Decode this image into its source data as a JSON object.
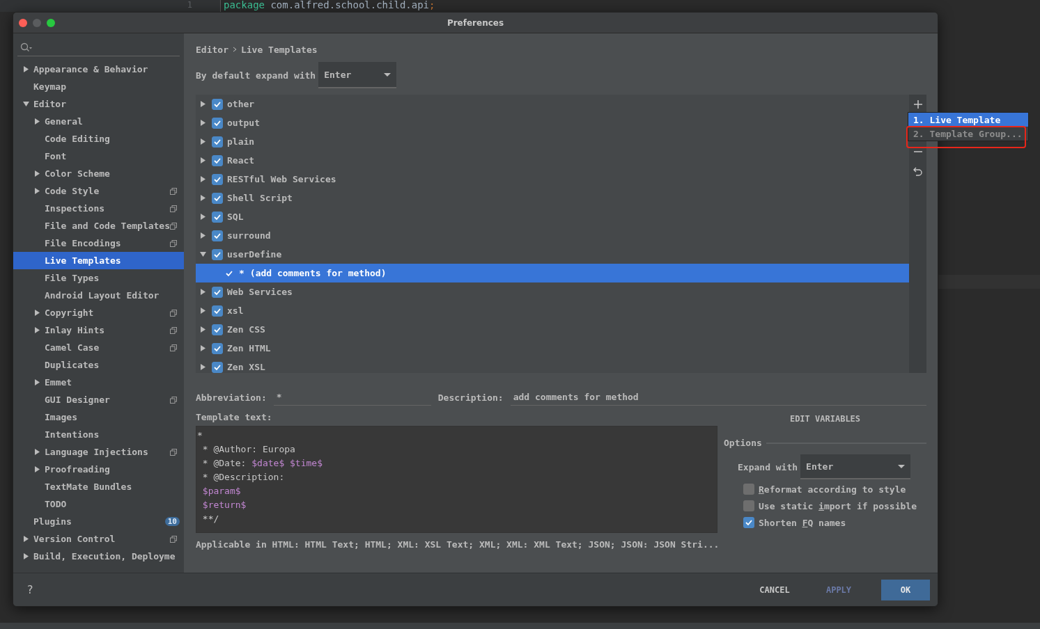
{
  "background_editor": {
    "line_number": "1",
    "code": [
      {
        "text": "package",
        "kind": "keyword"
      },
      {
        "text": " com.alfred.school.child.api",
        "kind": "plain"
      },
      {
        "text": ";",
        "kind": "punct"
      }
    ]
  },
  "window": {
    "title": "Preferences"
  },
  "sidebar": {
    "items": [
      {
        "label": "Appearance & Behavior",
        "expanded": false,
        "has_children": true,
        "selected": false
      },
      {
        "label": "Keymap",
        "selected": false
      },
      {
        "label": "Editor",
        "expanded": true,
        "has_children": true,
        "selected": false,
        "children": [
          {
            "label": "General",
            "has_children": true,
            "expanded": false,
            "selected": false
          },
          {
            "label": "Code Editing",
            "selected": false
          },
          {
            "label": "Font",
            "selected": false
          },
          {
            "label": "Color Scheme",
            "has_children": true,
            "expanded": false,
            "selected": false
          },
          {
            "label": "Code Style",
            "has_children": true,
            "expanded": false,
            "selected": false,
            "project_scoped": true
          },
          {
            "label": "Inspections",
            "selected": false,
            "project_scoped": true
          },
          {
            "label": "File and Code Templates",
            "selected": false,
            "project_scoped": true
          },
          {
            "label": "File Encodings",
            "selected": false,
            "project_scoped": true
          },
          {
            "label": "Live Templates",
            "selected": true
          },
          {
            "label": "File Types",
            "selected": false
          },
          {
            "label": "Android Layout Editor",
            "selected": false
          },
          {
            "label": "Copyright",
            "has_children": true,
            "expanded": false,
            "selected": false,
            "project_scoped": true
          },
          {
            "label": "Inlay Hints",
            "has_children": true,
            "expanded": false,
            "selected": false,
            "project_scoped": true
          },
          {
            "label": "Camel Case",
            "selected": false,
            "project_scoped": true
          },
          {
            "label": "Duplicates",
            "selected": false
          },
          {
            "label": "Emmet",
            "has_children": true,
            "expanded": false,
            "selected": false
          },
          {
            "label": "GUI Designer",
            "selected": false,
            "project_scoped": true
          },
          {
            "label": "Images",
            "selected": false
          },
          {
            "label": "Intentions",
            "selected": false
          },
          {
            "label": "Language Injections",
            "has_children": true,
            "expanded": false,
            "selected": false,
            "project_scoped": true
          },
          {
            "label": "Proofreading",
            "has_children": true,
            "expanded": false,
            "selected": false
          },
          {
            "label": "TextMate Bundles",
            "selected": false
          },
          {
            "label": "TODO",
            "selected": false
          }
        ]
      },
      {
        "label": "Plugins",
        "selected": false,
        "badge": "10"
      },
      {
        "label": "Version Control",
        "has_children": true,
        "expanded": false,
        "selected": false,
        "project_scoped": true
      },
      {
        "label": "Build, Execution, Deployme",
        "has_children": true,
        "expanded": false,
        "selected": false
      }
    ]
  },
  "breadcrumb": [
    "Editor",
    "Live Templates"
  ],
  "default_expand": {
    "label": "By default expand with",
    "value": "Enter"
  },
  "template_groups": [
    {
      "name": "other",
      "expanded": false,
      "checked": true
    },
    {
      "name": "output",
      "expanded": false,
      "checked": true
    },
    {
      "name": "plain",
      "expanded": false,
      "checked": true
    },
    {
      "name": "React",
      "expanded": false,
      "checked": true
    },
    {
      "name": "RESTful Web Services",
      "expanded": false,
      "checked": true
    },
    {
      "name": "Shell Script",
      "expanded": false,
      "checked": true
    },
    {
      "name": "SQL",
      "expanded": false,
      "checked": true
    },
    {
      "name": "surround",
      "expanded": false,
      "checked": true
    },
    {
      "name": "userDefine",
      "expanded": true,
      "checked": true,
      "children": [
        {
          "abbreviation": "*",
          "description": "(add comments for method)",
          "checked": true,
          "selected": true
        }
      ]
    },
    {
      "name": "Web Services",
      "expanded": false,
      "checked": true
    },
    {
      "name": "xsl",
      "expanded": false,
      "checked": true
    },
    {
      "name": "Zen CSS",
      "expanded": false,
      "checked": true
    },
    {
      "name": "Zen HTML",
      "expanded": false,
      "checked": true
    },
    {
      "name": "Zen XSL",
      "expanded": false,
      "checked": true
    }
  ],
  "add_menu": {
    "items": [
      {
        "label": "1. Live Template",
        "selected": true
      },
      {
        "label": "2. Template Group...",
        "selected": false,
        "highlighted": true
      }
    ]
  },
  "abbreviation": {
    "label": "Abbreviation:",
    "value": "*"
  },
  "description": {
    "label": "Description:",
    "value": "add comments for method"
  },
  "template_text": {
    "label": "Template text:",
    "lines": [
      {
        "indent": false,
        "segments": [
          {
            "text": "*",
            "kind": "text"
          }
        ]
      },
      {
        "indent": true,
        "segments": [
          {
            "text": "* @Author: Europa",
            "kind": "text"
          }
        ]
      },
      {
        "indent": true,
        "segments": [
          {
            "text": "* @Date: ",
            "kind": "text"
          },
          {
            "text": "$date$",
            "kind": "variable"
          },
          {
            "text": "$time$",
            "kind": "variable",
            "space_before": true
          }
        ]
      },
      {
        "indent": true,
        "segments": [
          {
            "text": "* @Description:",
            "kind": "text"
          }
        ]
      },
      {
        "indent": true,
        "segments": [
          {
            "text": "$param$",
            "kind": "variable"
          }
        ]
      },
      {
        "indent": true,
        "segments": [
          {
            "text": "$return$",
            "kind": "variable"
          }
        ]
      },
      {
        "indent": true,
        "segments": [
          {
            "text": "**/",
            "kind": "text"
          }
        ]
      }
    ]
  },
  "applicable": "Applicable in HTML: HTML Text; HTML; XML: XSL Text; XML; XML: XML Text; JSON; JSON: JSON Stri...",
  "edit_variables": "EDIT VARIABLES",
  "options": {
    "title": "Options",
    "expand_label": "Expand with",
    "expand_value": "Enter",
    "checkboxes": [
      {
        "mnemonic": "R",
        "after": "eformat according to style",
        "checked": false
      },
      {
        "before": "Use static ",
        "mnemonic": "i",
        "after": "mport if possible",
        "checked": false
      },
      {
        "before": "Shorten ",
        "mnemonic": "F",
        "after": "Q names",
        "checked": true
      }
    ]
  },
  "footer": {
    "help": "?",
    "buttons": [
      {
        "label": "CANCEL",
        "kind": "normal",
        "disabled": false
      },
      {
        "label": "APPLY",
        "kind": "normal",
        "disabled": true
      },
      {
        "label": "OK",
        "kind": "default",
        "disabled": false
      }
    ]
  }
}
